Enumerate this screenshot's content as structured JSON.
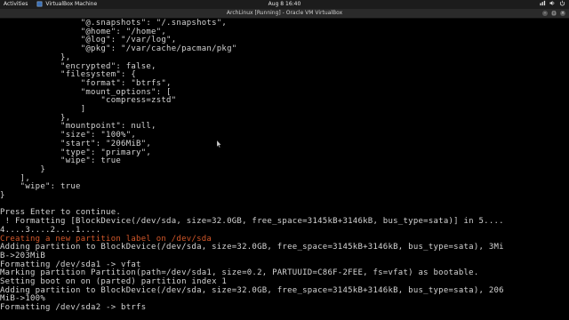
{
  "system_bar": {
    "activities": "Activities",
    "app_name": "VirtualBox Machine",
    "clock": "Aug 8  16:40"
  },
  "vm_window": {
    "title": "ArchLinux [Running] - Oracle VM VirtualBox"
  },
  "console_lines": [
    {
      "text": "                \"@.snapshots\": \"/.snapshots\",",
      "color": "default"
    },
    {
      "text": "                \"@home\": \"/home\",",
      "color": "default"
    },
    {
      "text": "                \"@log\": \"/var/log\",",
      "color": "default"
    },
    {
      "text": "                \"@pkg\": \"/var/cache/pacman/pkg\"",
      "color": "default"
    },
    {
      "text": "            },",
      "color": "default"
    },
    {
      "text": "            \"encrypted\": false,",
      "color": "default"
    },
    {
      "text": "            \"filesystem\": {",
      "color": "default"
    },
    {
      "text": "                \"format\": \"btrfs\",",
      "color": "default"
    },
    {
      "text": "                \"mount_options\": [",
      "color": "default"
    },
    {
      "text": "                    \"compress=zstd\"",
      "color": "default"
    },
    {
      "text": "                ]",
      "color": "default"
    },
    {
      "text": "            },",
      "color": "default"
    },
    {
      "text": "            \"mountpoint\": null,",
      "color": "default"
    },
    {
      "text": "            \"size\": \"100%\",",
      "color": "default"
    },
    {
      "text": "            \"start\": \"206MiB\",",
      "color": "default"
    },
    {
      "text": "            \"type\": \"primary\",",
      "color": "default"
    },
    {
      "text": "            \"wipe\": true",
      "color": "default"
    },
    {
      "text": "        }",
      "color": "default"
    },
    {
      "text": "    ],",
      "color": "default"
    },
    {
      "text": "    \"wipe\": true",
      "color": "default"
    },
    {
      "text": "}",
      "color": "default"
    },
    {
      "text": "",
      "color": "default"
    },
    {
      "text": "Press Enter to continue.",
      "color": "default"
    },
    {
      "text": " ! Formatting [BlockDevice(/dev/sda, size=32.0GB, free_space=3145kB+3146kB, bus_type=sata)] in 5....",
      "color": "default"
    },
    {
      "text": "4....3....2....1....",
      "color": "default"
    },
    {
      "text": "Creating a new partition label on /dev/sda",
      "color": "red"
    },
    {
      "text": "Adding partition to BlockDevice(/dev/sda, size=32.0GB, free_space=3145kB+3146kB, bus_type=sata), 3Mi",
      "color": "default"
    },
    {
      "text": "B->203MiB",
      "color": "default"
    },
    {
      "text": "Formatting /dev/sda1 -> vfat",
      "color": "default"
    },
    {
      "text": "Marking partition Partition(path=/dev/sda1, size=0.2, PARTUUID=C86F-2FEE, fs=vfat) as bootable.",
      "color": "default"
    },
    {
      "text": "Setting boot on on (parted) partition index 1",
      "color": "default"
    },
    {
      "text": "Adding partition to BlockDevice(/dev/sda, size=32.0GB, free_space=3145kB+3146kB, bus_type=sata), 206",
      "color": "default"
    },
    {
      "text": "MiB->100%",
      "color": "default"
    },
    {
      "text": "Formatting /dev/sda2 -> btrfs",
      "color": "default"
    }
  ],
  "colors": {
    "default_text": "#d4d4d4",
    "highlight_text": "#d5582a",
    "background": "#000000"
  },
  "icons": [
    "virtualbox-icon",
    "network-icon",
    "volume-icon",
    "power-icon",
    "minimize-icon",
    "maximize-icon",
    "close-icon",
    "mouse-pointer-icon"
  ]
}
